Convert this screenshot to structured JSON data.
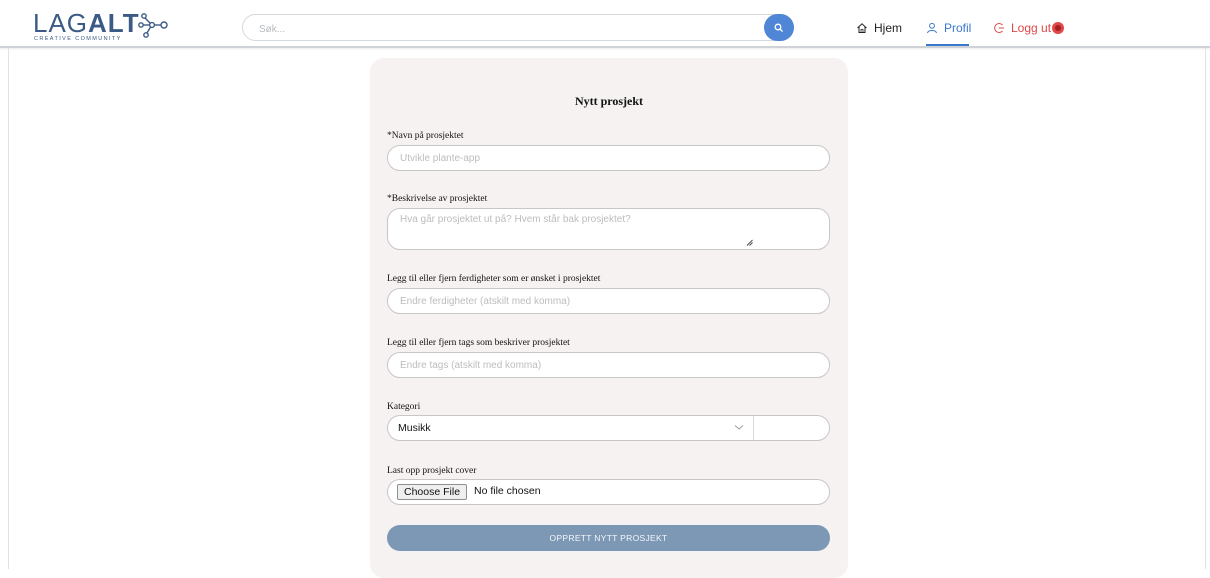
{
  "header": {
    "logo": {
      "name": "LAGALT",
      "name_light": "LAG",
      "name_bold": "ALT",
      "tagline": "CREATIVE COMMUNITY"
    },
    "search": {
      "placeholder": "Søk..."
    },
    "nav": {
      "home": "Hjem",
      "profile": "Profil",
      "logout": "Logg ut"
    }
  },
  "form": {
    "title": "Nytt prosjekt",
    "name": {
      "label": "*Navn på prosjektet",
      "placeholder": "Utvikle plante-app"
    },
    "description": {
      "label": "*Beskrivelse av prosjektet",
      "placeholder": "Hva går prosjektet ut på? Hvem står bak prosjektet?"
    },
    "skills": {
      "label": "Legg til eller fjern ferdigheter som er ønsket i prosjektet",
      "placeholder": "Endre ferdigheter (atskilt med komma)"
    },
    "tags": {
      "label": "Legg til eller fjern tags som beskriver prosjektet",
      "placeholder": "Endre tags (atskilt med komma)"
    },
    "category": {
      "label": "Kategori",
      "selected": "Musikk"
    },
    "cover": {
      "label": "Last opp prosjekt cover",
      "button": "Choose File",
      "status": "No file chosen"
    },
    "submit": "OPPRETT NYTT PROSJEKT"
  },
  "colors": {
    "brand": "#3b5a86",
    "accent": "#3a78c9",
    "danger": "#e04848",
    "submit": "#7c98b4",
    "card": "#f5f2f1"
  },
  "icons": [
    "molecule-logo-icon",
    "search-icon",
    "home-icon",
    "user-icon",
    "logout-icon",
    "chevron-down-icon",
    "resize-handle-icon"
  ]
}
